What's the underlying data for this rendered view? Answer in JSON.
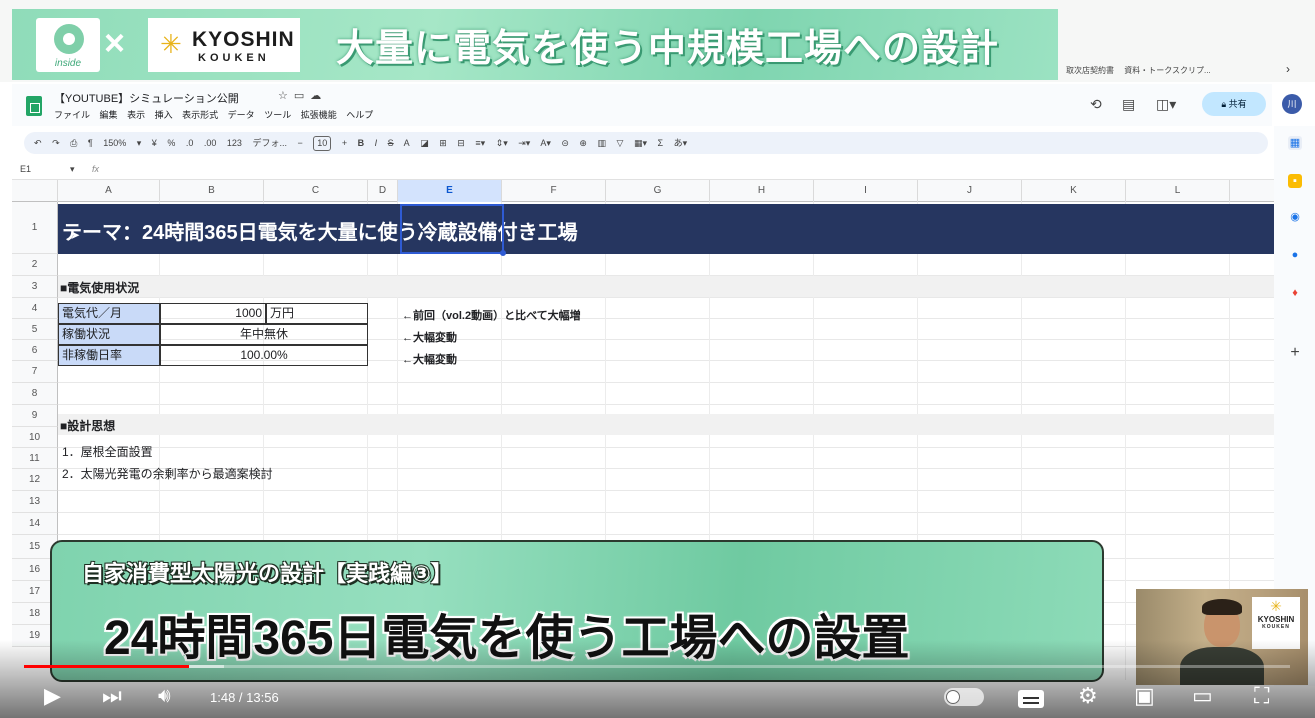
{
  "banner": {
    "times": "×",
    "inside_label": "inside",
    "kyoshin_line1": "KYOSHIN",
    "kyoshin_line2": "KOUKEN",
    "title": "大量に電気を使う中規模工場への設計"
  },
  "bookmarks": [
    "取次店契約書",
    "資料・トークスクリプ..."
  ],
  "sheets": {
    "doc_title": "【YOUTUBE】シミュレーション公開",
    "menu": [
      "ファイル",
      "編集",
      "表示",
      "挿入",
      "表示形式",
      "データ",
      "ツール",
      "拡張機能",
      "ヘルプ"
    ],
    "share_label": "共有",
    "avatar": "川",
    "zoom": "150%",
    "font": "デフォ...",
    "font_size": "10",
    "toolbar_items": [
      "¥",
      "%",
      ".0",
      ".00",
      "123"
    ],
    "cell_ref": "E1",
    "fx": "fx"
  },
  "grid": {
    "columns": [
      "A",
      "B",
      "C",
      "D",
      "E",
      "F",
      "G",
      "H",
      "I",
      "J",
      "K",
      "L"
    ],
    "rows": [
      "1",
      "2",
      "3",
      "4",
      "5",
      "6",
      "7",
      "8",
      "9",
      "10",
      "11",
      "12",
      "13",
      "14",
      "15",
      "16",
      "17",
      "18",
      "19"
    ],
    "title": "テーマ：24時間365日電気を大量に使う冷蔵設備付き工場",
    "section1": "■電気使用状況",
    "table": [
      {
        "label": "電気代／月",
        "value": "1000",
        "unit": "万円",
        "note": "←前回（vol.2動画）と比べて大幅増"
      },
      {
        "label": "稼働状況",
        "value": "年中無休",
        "unit": "",
        "note": "←大幅変動"
      },
      {
        "label": "非稼働日率",
        "value": "100.00%",
        "unit": "",
        "note": "←大幅変動"
      }
    ],
    "section2": "■設計思想",
    "items": [
      "1．屋根全面設置",
      "2．太陽光発電の余剰率から最適案検討"
    ]
  },
  "overlay": {
    "subtitle": "自家消費型太陽光の設計【実践編③】",
    "main": "24時間365日電気を使う工場への設置"
  },
  "webcam": {
    "sign_line1": "KYOSHIN",
    "sign_line2": "KOUKEN"
  },
  "player": {
    "time": "1:48 / 13:56",
    "progress": 0.13
  },
  "colors": {
    "title_bar": "#263660",
    "label_cell": "#c9daf8",
    "banner_green": "#8fdcb9",
    "progress": "#ff0000"
  }
}
